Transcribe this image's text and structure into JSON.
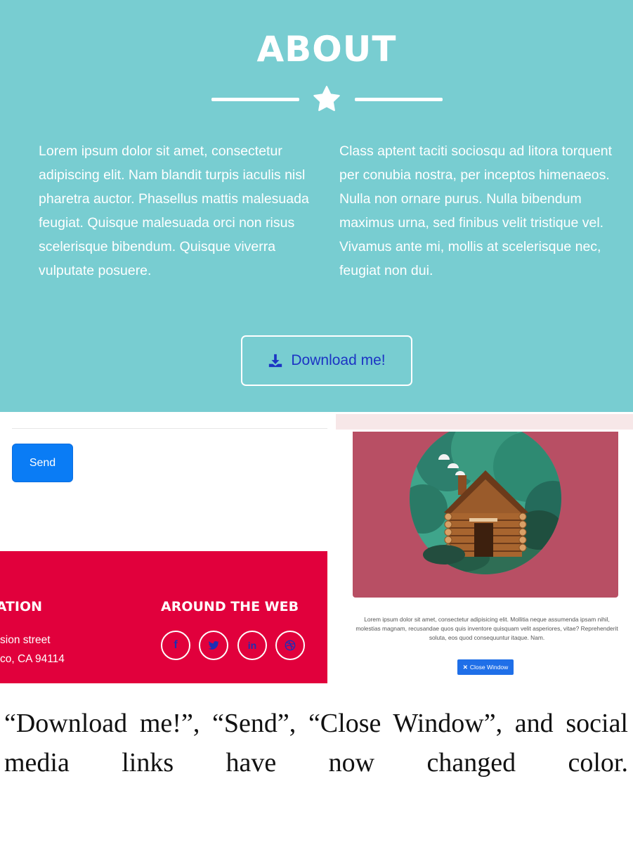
{
  "about": {
    "title": "ABOUT",
    "star_icon": "star-icon",
    "col_left": "Lorem ipsum dolor sit amet, consectetur adipiscing elit. Nam blandit turpis iaculis nisl pharetra auctor. Phasellus mattis malesuada feugiat. Quisque malesuada orci non risus scelerisque bibendum. Quisque viverra vulputate posuere.",
    "col_right": "Class aptent taciti sociosqu ad litora torquent per conubia nostra, per inceptos himenaeos. Nulla non ornare purus. Nulla bibendum maximus urna, sed finibus velit tristique vel. Vivamus ante mi, mollis at scelerisque nec, feugiat non dui.",
    "download_label": "Download me!",
    "download_icon": "download-icon",
    "background": "#78cdd1",
    "button_text_color": "#1c34c4"
  },
  "form": {
    "send_label": "Send",
    "send_color": "#0a7cf5"
  },
  "footer": {
    "location_heading_fragment": "ATION",
    "address_line1_fragment": "sion street",
    "address_line2_fragment": "co, CA 94114",
    "around_web_heading": "AROUND THE WEB",
    "social_links": [
      {
        "icon": "facebook-icon",
        "glyph": "f"
      },
      {
        "icon": "twitter-icon",
        "glyph": ""
      },
      {
        "icon": "linkedin-icon",
        "glyph": "in"
      },
      {
        "icon": "dribbble-icon",
        "glyph": ""
      }
    ],
    "background": "#e1003c",
    "social_color": "#1c2fb5"
  },
  "modal": {
    "image_icon": "log-cabin-illustration",
    "body_text": "Lorem ipsum dolor sit amet, consectetur adipisicing elit. Mollitia neque assumenda ipsam nihil, molestias magnam, recusandae quos quis inventore quisquam velit asperiores, vitae? Reprehenderit soluta, eos quod consequuntur itaque. Nam.",
    "close_label": "Close Window",
    "close_icon": "close-icon",
    "image_background": "#b84f64"
  },
  "caption": "“Download me!”, “Send”, “Close Window”, and social media links have now changed color."
}
